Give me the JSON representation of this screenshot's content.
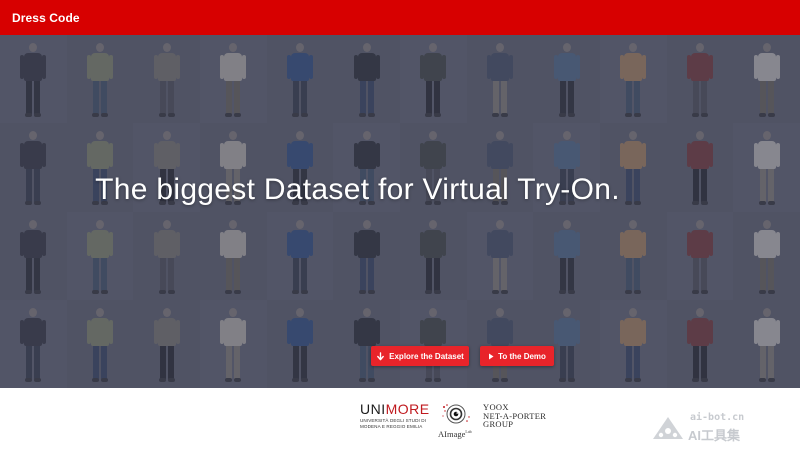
{
  "header": {
    "brand": "Dress Code",
    "background_color": "#d70000"
  },
  "hero": {
    "headline": "The biggest Dataset for Virtual Try-On.",
    "overlay_color": "#46485c",
    "gallery_description_icon": "model-photo-grid",
    "buttons": [
      {
        "label": "Explore the Dataset",
        "icon": "arrow-down-icon"
      },
      {
        "label": "To the Demo",
        "icon": "play-triangle-icon"
      }
    ],
    "button_color": "#e8242a"
  },
  "footer": {
    "unimore": {
      "word_left": "UNI",
      "word_right": "MORE",
      "subtitle_line1": "UNIVERSITÀ DEGLI STUDI DI",
      "subtitle_line2": "MODENA E REGGIO EMILIA"
    },
    "aimage": {
      "name": "AImage",
      "sup": "Lab"
    },
    "ynap": {
      "line1": "YOOX",
      "line2": "NET-A-PORTER",
      "line3": "GROUP"
    },
    "watermark": {
      "domain": "ai-bot.cn",
      "text": "AI工具集"
    }
  }
}
